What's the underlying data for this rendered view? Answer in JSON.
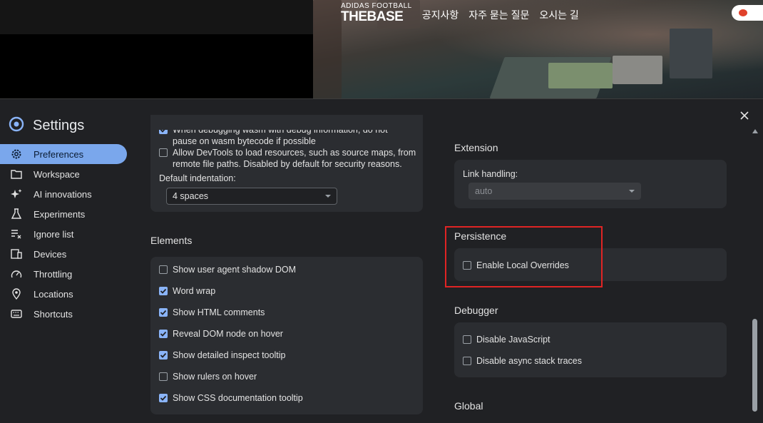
{
  "site": {
    "brand_small": "ADIDAS FOOTBALL",
    "brand_big": "THEBASE",
    "nav": [
      "공지사항",
      "자주 묻는 질문",
      "오시는 길"
    ],
    "lang": " "
  },
  "settings": {
    "title": "Settings",
    "close_icon": "close-icon",
    "nav": [
      {
        "label": "Preferences",
        "icon": "gear-icon",
        "active": true
      },
      {
        "label": "Workspace",
        "icon": "folder-icon"
      },
      {
        "label": "AI innovations",
        "icon": "sparkle-icon"
      },
      {
        "label": "Experiments",
        "icon": "flask-icon"
      },
      {
        "label": "Ignore list",
        "icon": "ignore-list-icon"
      },
      {
        "label": "Devices",
        "icon": "devices-icon"
      },
      {
        "label": "Throttling",
        "icon": "gauge-icon"
      },
      {
        "label": "Locations",
        "icon": "pin-icon"
      },
      {
        "label": "Shortcuts",
        "icon": "keyboard-icon"
      }
    ],
    "sources": {
      "wasm_line1": "When debugging wasm with debug information, do not",
      "wasm_line2": "pause on wasm bytecode if possible",
      "wasm_checked": true,
      "allow_line1": "Allow DevTools to load resources, such as source maps, from",
      "allow_line2": "remote file paths. Disabled by default for security reasons.",
      "allow_checked": false,
      "indent_label": "Default indentation:",
      "indent_value": "4 spaces"
    },
    "elements": {
      "heading": "Elements",
      "items": [
        {
          "label": "Show user agent shadow DOM",
          "checked": false
        },
        {
          "label": "Word wrap",
          "checked": true
        },
        {
          "label": "Show HTML comments",
          "checked": true
        },
        {
          "label": "Reveal DOM node on hover",
          "checked": true
        },
        {
          "label": "Show detailed inspect tooltip",
          "checked": true
        },
        {
          "label": "Show rulers on hover",
          "checked": false
        },
        {
          "label": "Show CSS documentation tooltip",
          "checked": true
        }
      ]
    },
    "extension": {
      "heading": "Extension",
      "link_label": "Link handling:",
      "link_value": "auto"
    },
    "persistence": {
      "heading": "Persistence",
      "items": [
        {
          "label": "Enable Local Overrides",
          "checked": false
        }
      ]
    },
    "debugger": {
      "heading": "Debugger",
      "items": [
        {
          "label": "Disable JavaScript",
          "checked": false
        },
        {
          "label": "Disable async stack traces",
          "checked": false
        }
      ]
    },
    "global": {
      "heading": "Global"
    }
  },
  "colors": {
    "accent": "#7aa7ec",
    "checkbox_on": "#8ab4f8",
    "panel_bg": "#202124",
    "card_bg": "#2b2d31",
    "highlight": "#e02424"
  }
}
